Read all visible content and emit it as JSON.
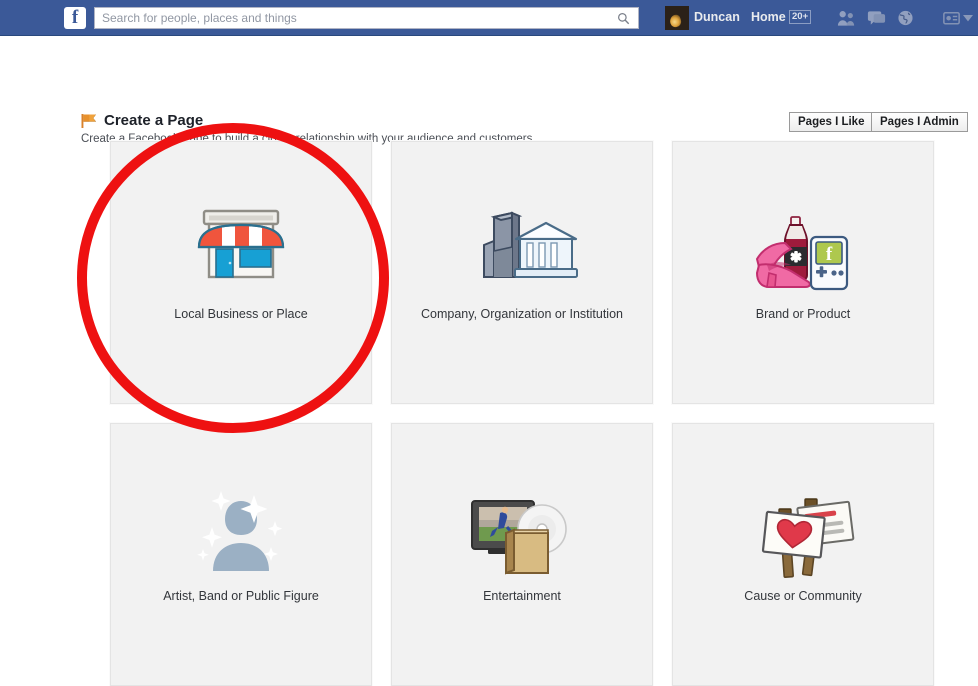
{
  "navbar": {
    "logo_letter": "f",
    "search": {
      "placeholder": "Search for people, places and things",
      "value": "",
      "icon": "search-icon"
    },
    "profile_name": "Duncan",
    "home_label": "Home",
    "notification_badge": "20+",
    "icons": [
      {
        "name": "friend-requests-icon"
      },
      {
        "name": "messages-icon"
      },
      {
        "name": "notifications-globe-icon"
      },
      {
        "name": "privacy-shortcuts-icon"
      },
      {
        "name": "account-settings-caret-icon"
      }
    ],
    "colors": {
      "background": "#3b5998",
      "border": "#29487d",
      "text": "#e9ebee"
    }
  },
  "page": {
    "flag_icon": "orange-flag-icon",
    "title": "Create a Page",
    "subtitle": "Create a Facebook Page to build a closer relationship with your audience and customers.",
    "buttons": {
      "pages_i_like": "Pages I Like",
      "pages_i_admin": "Pages I Admin"
    }
  },
  "cards": [
    {
      "label": "Local Business or Place",
      "icon": "storefront-icon"
    },
    {
      "label": "Company, Organization or Institution",
      "icon": "buildings-icon"
    },
    {
      "label": "Brand or Product",
      "icon": "shoe-bottle-gadget-icon"
    },
    {
      "label": "Artist, Band or Public Figure",
      "icon": "sparkle-person-icon"
    },
    {
      "label": "Entertainment",
      "icon": "tv-disc-book-icon"
    },
    {
      "label": "Cause or Community",
      "icon": "protest-signs-icon"
    }
  ],
  "annotation": {
    "shape": "ellipse",
    "color": "#ee1111",
    "stroke_width": 10,
    "targets_card_index": 0
  }
}
